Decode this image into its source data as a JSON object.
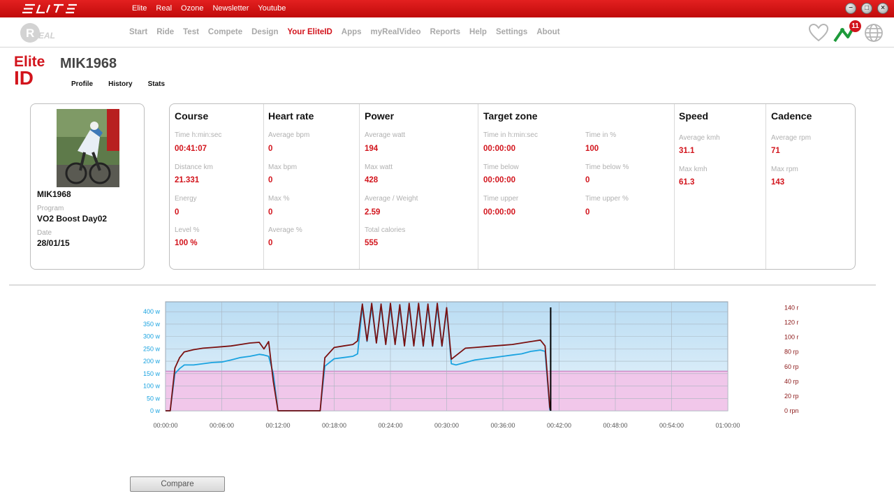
{
  "app": {
    "top_nav": [
      "Elite",
      "Real",
      "Ozone",
      "Newsletter",
      "Youtube"
    ],
    "main_nav": [
      "Start",
      "Ride",
      "Test",
      "Compete",
      "Design",
      "Your EliteID",
      "Apps",
      "myRealVideo",
      "Reports",
      "Help",
      "Settings",
      "About"
    ],
    "active_nav": "Your EliteID",
    "notification_count": "11"
  },
  "header": {
    "brand_line1": "Elite",
    "brand_line2": "ID",
    "username": "MIK1968",
    "tabs": [
      "Profile",
      "History",
      "Stats"
    ]
  },
  "profile": {
    "name": "MIK1968",
    "program_label": "Program",
    "program": "VO2 Boost Day02",
    "date_label": "Date",
    "date": "28/01/15"
  },
  "stats": {
    "course": {
      "title": "Course",
      "time_label": "Time h:min:sec",
      "time": "00:41:07",
      "distance_label": "Distance km",
      "distance": "21.331",
      "energy_label": "Energy",
      "energy": "0",
      "level_label": "Level %",
      "level": "100 %"
    },
    "heart_rate": {
      "title": "Heart rate",
      "avg_label": "Average bpm",
      "avg": "0",
      "max_label": "Max bpm",
      "max": "0",
      "maxpct_label": "Max %",
      "maxpct": "0",
      "avgpct_label": "Average %",
      "avgpct": "0"
    },
    "power": {
      "title": "Power",
      "avg_label": "Average watt",
      "avg": "194",
      "max_label": "Max watt",
      "max": "428",
      "weight_label": "Average / Weight",
      "weight": "2.59",
      "cal_label": "Total calories",
      "cal": "555"
    },
    "target_zone": {
      "title": "Target zone",
      "time_in_label": "Time in h:min:sec",
      "time_in": "00:00:00",
      "time_in_pct_label": "Time in %",
      "time_in_pct": "100",
      "time_below_label": "Time below",
      "time_below": "00:00:00",
      "time_below_pct_label": "Time below %",
      "time_below_pct": "0",
      "time_upper_label": "Time upper",
      "time_upper": "00:00:00",
      "time_upper_pct_label": "Time upper %",
      "time_upper_pct": "0"
    },
    "speed": {
      "title": "Speed",
      "avg_label": "Average kmh",
      "avg": "31.1",
      "max_label": "Max kmh",
      "max": "61.3"
    },
    "cadence": {
      "title": "Cadence",
      "avg_label": "Average rpm",
      "avg": "71",
      "max_label": "Max rpm",
      "max": "143"
    }
  },
  "compare_label": "Compare",
  "chart_data": {
    "type": "line",
    "y_left_ticks": [
      "0 w",
      "50 w",
      "100 w",
      "150 w",
      "200 w",
      "250 w",
      "300 w",
      "350 w",
      "400 w"
    ],
    "y_right_ticks": [
      "0 rpn",
      "20 rp",
      "40 rp",
      "60 rp",
      "80 rp",
      "100 r",
      "120 r",
      "140 r"
    ],
    "x_ticks": [
      "00:00:00",
      "00:06:00",
      "00:12:00",
      "00:18:00",
      "00:24:00",
      "00:30:00",
      "00:36:00",
      "00:42:00",
      "00:48:00",
      "00:54:00",
      "01:00:00"
    ],
    "xlim_min": [
      0,
      60
    ],
    "ylim_w": [
      0,
      440
    ],
    "ylim_rpm": [
      0,
      148
    ],
    "target_zone_w": 160,
    "cursor_min": 41.1,
    "series": [
      {
        "color": "#1aa3e0",
        "axis": "w",
        "points": [
          [
            0,
            0
          ],
          [
            0.5,
            0
          ],
          [
            1,
            150
          ],
          [
            1.5,
            170
          ],
          [
            2,
            185
          ],
          [
            3,
            185
          ],
          [
            4,
            190
          ],
          [
            5,
            195
          ],
          [
            6,
            197
          ],
          [
            7,
            205
          ],
          [
            8,
            215
          ],
          [
            9,
            220
          ],
          [
            10,
            228
          ],
          [
            10.5,
            225
          ],
          [
            11,
            220
          ],
          [
            11.5,
            150
          ],
          [
            12,
            0
          ],
          [
            13,
            0
          ],
          [
            16,
            0
          ],
          [
            16.5,
            0
          ],
          [
            17,
            180
          ],
          [
            18,
            210
          ],
          [
            19,
            215
          ],
          [
            20,
            220
          ],
          [
            20.5,
            230
          ],
          [
            21,
            420
          ],
          [
            21.5,
            280
          ],
          [
            22,
            420
          ],
          [
            22.5,
            275
          ],
          [
            23,
            420
          ],
          [
            23.5,
            270
          ],
          [
            24,
            420
          ],
          [
            24.5,
            270
          ],
          [
            25,
            415
          ],
          [
            25.5,
            265
          ],
          [
            26,
            420
          ],
          [
            26.5,
            265
          ],
          [
            27,
            425
          ],
          [
            27.5,
            260
          ],
          [
            28,
            420
          ],
          [
            28.5,
            260
          ],
          [
            29,
            420
          ],
          [
            29.5,
            260
          ],
          [
            30,
            410
          ],
          [
            30.5,
            190
          ],
          [
            31,
            185
          ],
          [
            32,
            195
          ],
          [
            33,
            205
          ],
          [
            34,
            210
          ],
          [
            35,
            215
          ],
          [
            36,
            220
          ],
          [
            37,
            225
          ],
          [
            38,
            230
          ],
          [
            39,
            240
          ],
          [
            40,
            245
          ],
          [
            40.5,
            240
          ],
          [
            41,
            5
          ],
          [
            41.1,
            0
          ]
        ]
      },
      {
        "color": "#7a1010",
        "axis": "rpm",
        "points": [
          [
            0,
            0
          ],
          [
            0.5,
            0
          ],
          [
            1,
            58
          ],
          [
            1.5,
            72
          ],
          [
            2,
            80
          ],
          [
            3,
            83
          ],
          [
            4,
            85
          ],
          [
            5,
            86
          ],
          [
            6,
            87
          ],
          [
            7,
            88
          ],
          [
            8,
            90
          ],
          [
            9,
            92
          ],
          [
            10,
            93
          ],
          [
            10.5,
            84
          ],
          [
            11,
            94
          ],
          [
            11.5,
            40
          ],
          [
            12,
            0
          ],
          [
            13,
            0
          ],
          [
            16,
            0
          ],
          [
            16.5,
            0
          ],
          [
            17,
            72
          ],
          [
            18,
            86
          ],
          [
            19,
            88
          ],
          [
            20,
            90
          ],
          [
            20.5,
            95
          ],
          [
            21,
            145
          ],
          [
            21.5,
            95
          ],
          [
            22,
            146
          ],
          [
            22.5,
            92
          ],
          [
            23,
            145
          ],
          [
            23.5,
            90
          ],
          [
            24,
            146
          ],
          [
            24.5,
            90
          ],
          [
            25,
            144
          ],
          [
            25.5,
            88
          ],
          [
            26,
            146
          ],
          [
            26.5,
            88
          ],
          [
            27,
            146
          ],
          [
            27.5,
            88
          ],
          [
            28,
            145
          ],
          [
            28.5,
            88
          ],
          [
            29,
            146
          ],
          [
            29.5,
            88
          ],
          [
            30,
            140
          ],
          [
            30.5,
            70
          ],
          [
            31,
            75
          ],
          [
            32,
            85
          ],
          [
            33,
            86
          ],
          [
            34,
            87
          ],
          [
            35,
            88
          ],
          [
            36,
            89
          ],
          [
            37,
            90
          ],
          [
            38,
            92
          ],
          [
            39,
            94
          ],
          [
            40,
            96
          ],
          [
            40.5,
            88
          ],
          [
            41,
            5
          ],
          [
            41.1,
            0
          ]
        ]
      }
    ],
    "colors": {
      "plot_bg_top": "#b9dcf3",
      "plot_bg_bottom": "#e9f4fb",
      "zone": "#f2c2e8",
      "zone_border": "#c070b8",
      "grid": "#a8b4bf",
      "cursor": "#000000",
      "left_axis": "#1aa3e0",
      "right_axis": "#8a1515"
    }
  }
}
